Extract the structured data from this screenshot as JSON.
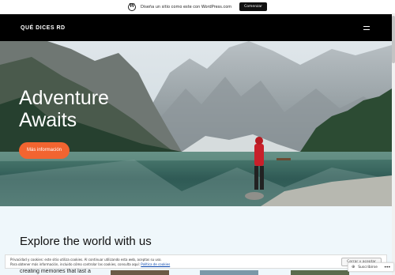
{
  "promo_bar": {
    "text": "Diseña un sitio como este con WordPress.com",
    "cta_label": "Comenzar",
    "icon": "wordpress-logo-icon"
  },
  "header": {
    "site_title": "QUÉ DICES RD",
    "menu_icon": "hamburger-menu-icon"
  },
  "hero": {
    "title_line1": "Adventure",
    "title_line2": "Awaits",
    "button_label": "Más información",
    "button_color": "#f26430"
  },
  "section": {
    "title": "Explore the world with us",
    "text": "creating memories that last a"
  },
  "cookie_banner": {
    "line1": "Privacidad y cookies: este sitio utiliza cookies. Al continuar utilizando esta web, aceptas su uso.",
    "line2_prefix": "Para obtener más información, incluido cómo controlar las cookies, consulta aquí:",
    "link_label": "Política de cookies",
    "button_label": "Cerrar y aceptar"
  },
  "subscribe_widget": {
    "label": "Suscribirse",
    "icon": "follow-icon",
    "more_icon": "more-dots-icon"
  },
  "colors": {
    "header_bg": "#000000",
    "accent": "#f26430",
    "section_bg": "#eff7fb"
  }
}
